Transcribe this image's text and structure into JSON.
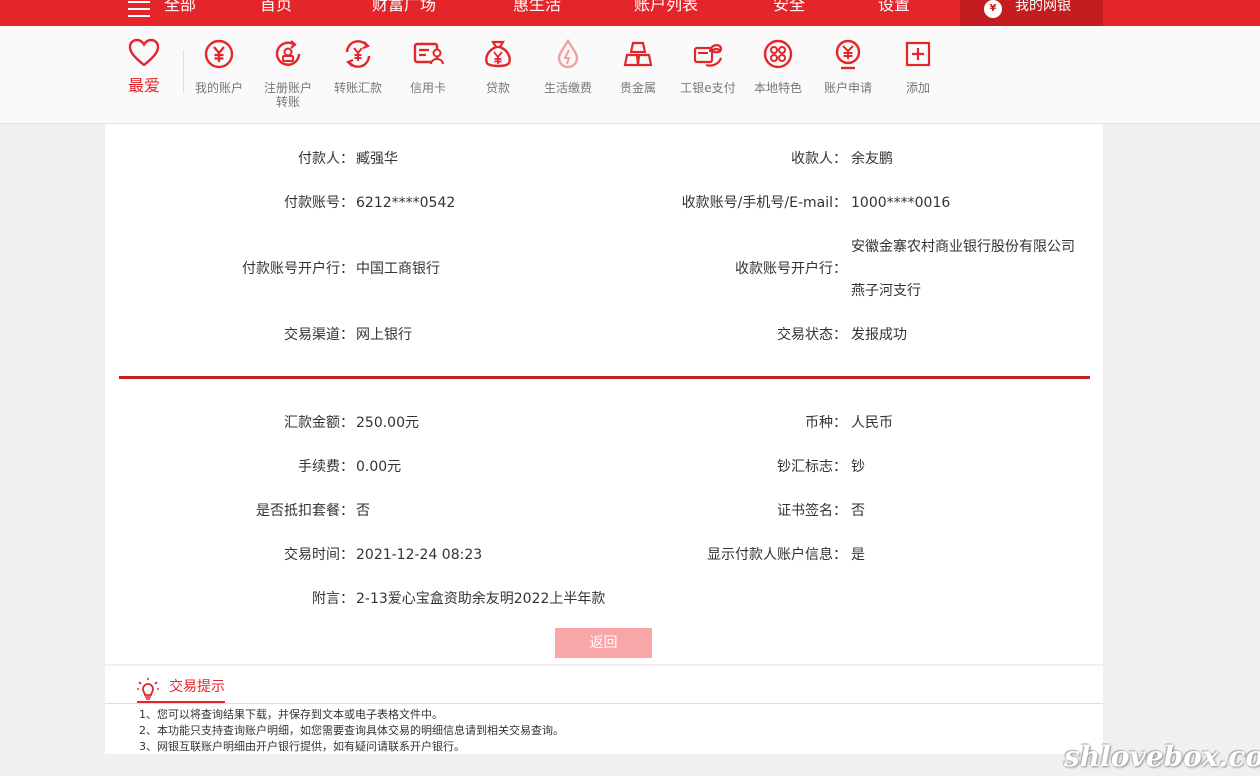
{
  "topnav": {
    "items": [
      "全部",
      "首页",
      "财富广场",
      "惠生活",
      "账户列表",
      "安全",
      "设置"
    ],
    "mybank_label": "我的网银",
    "mybank_icon": "yuan-coin-icon"
  },
  "toolbar": {
    "favorite_label": "最爱",
    "items": [
      {
        "label": "我的账户",
        "icon": "yuan-circle-icon"
      },
      {
        "label": "注册账户\n转账",
        "icon": "register-transfer-icon"
      },
      {
        "label": "转账汇款",
        "icon": "transfer-icon"
      },
      {
        "label": "信用卡",
        "icon": "credit-card-icon"
      },
      {
        "label": "贷款",
        "icon": "money-bag-icon"
      },
      {
        "label": "生活缴费",
        "icon": "drop-icon"
      },
      {
        "label": "贵金属",
        "icon": "gold-bars-icon"
      },
      {
        "label": "工银e支付",
        "icon": "epay-icon"
      },
      {
        "label": "本地特色",
        "icon": "local-feature-icon"
      },
      {
        "label": "账户申请",
        "icon": "apply-icon"
      },
      {
        "label": "添加",
        "icon": "plus-icon"
      }
    ]
  },
  "detail": {
    "payer_label": "付款人：",
    "payer": "臧强华",
    "payee_label": "收款人：",
    "payee": "余友鹏",
    "payer_account_label": "付款账号：",
    "payer_account": "6212****0542",
    "payee_account_label": "收款账号/手机号/E-mail：",
    "payee_account": "1000****0016",
    "payer_bank_label": "付款账号开户行：",
    "payer_bank": "中国工商银行",
    "payee_bank_label": "收款账号开户行：",
    "payee_bank_line1": "安徽金寨农村商业银行股份有限公司",
    "payee_bank_line2": "燕子河支行",
    "channel_label": "交易渠道：",
    "channel": "网上银行",
    "status_label": "交易状态：",
    "status": "发报成功",
    "amount_label": "汇款金额：",
    "amount": "250.00元",
    "currency_label": "币种：",
    "currency": "人民币",
    "fee_label": "手续费：",
    "fee": "0.00元",
    "cash_flag_label": "钞汇标志：",
    "cash_flag": "钞",
    "package_label": "是否抵扣套餐：",
    "package": "否",
    "cert_label": "证书签名：",
    "cert": "否",
    "time_label": "交易时间：",
    "time": "2021-12-24 08:23",
    "show_payer_label": "显示付款人账户信息：",
    "show_payer": "是",
    "memo_label": "附言：",
    "memo": "2-13爱心宝盒资助余友明2022上半年款",
    "back_button": "返回"
  },
  "tips": {
    "title": "交易提示",
    "lines": [
      "1、您可以将查询结果下载，并保存到文本或电子表格文件中。",
      "2、本功能只支持查询账户明细，如您需要查询具体交易的明细信息请到相关交易查询。",
      "3、网银互联账户明细由开户银行提供，如有疑问请联系开户银行。"
    ]
  },
  "watermark": "shlovebox.com",
  "colors": {
    "brand_red": "#e4262a",
    "dark_red": "#c31d20",
    "button_pink": "#f9a6a8",
    "divider_red": "#c41e22"
  }
}
